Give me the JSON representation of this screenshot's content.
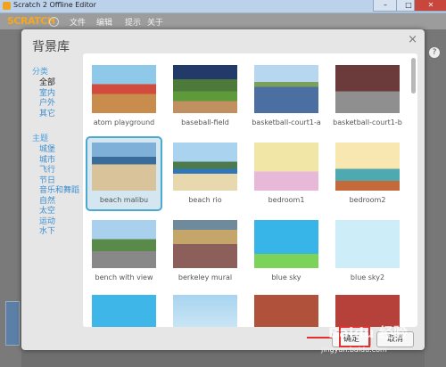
{
  "window": {
    "title": "Scratch 2 Offline Editor",
    "minimize": "–",
    "maximize": "□",
    "close": "✕"
  },
  "menu": {
    "logo": "SCRATCH",
    "items": [
      "文件",
      "编辑",
      "提示",
      "关于"
    ]
  },
  "dialog": {
    "title": "背景库",
    "close": "×",
    "category_heading": "分类",
    "categories": [
      "全部",
      "室内",
      "户外",
      "其它"
    ],
    "selected_category": "全部",
    "theme_heading": "主题",
    "themes": [
      "城堡",
      "城市",
      "飞行",
      "节日",
      "音乐和舞蹈",
      "自然",
      "太空",
      "运动",
      "水下"
    ],
    "tiles": [
      {
        "label": "atom playground"
      },
      {
        "label": "baseball-field"
      },
      {
        "label": "basketball-court1-a"
      },
      {
        "label": "basketball-court1-b"
      },
      {
        "label": "beach malibu"
      },
      {
        "label": "beach rio"
      },
      {
        "label": "bedroom1"
      },
      {
        "label": "bedroom2"
      },
      {
        "label": "bench with view"
      },
      {
        "label": "berkeley mural"
      },
      {
        "label": "blue sky"
      },
      {
        "label": "blue sky2"
      },
      {
        "label": ""
      },
      {
        "label": ""
      },
      {
        "label": ""
      },
      {
        "label": ""
      }
    ],
    "selected_tile": "beach malibu",
    "ok_label": "确定",
    "cancel_label": "取消"
  },
  "watermark": {
    "text": "jingyan.baidu.com",
    "logo_text": "Baidu 经验"
  },
  "colors": {
    "accent": "#4ba8cf",
    "category_link": "#3b8ed0",
    "annotation_red": "#e03030"
  }
}
